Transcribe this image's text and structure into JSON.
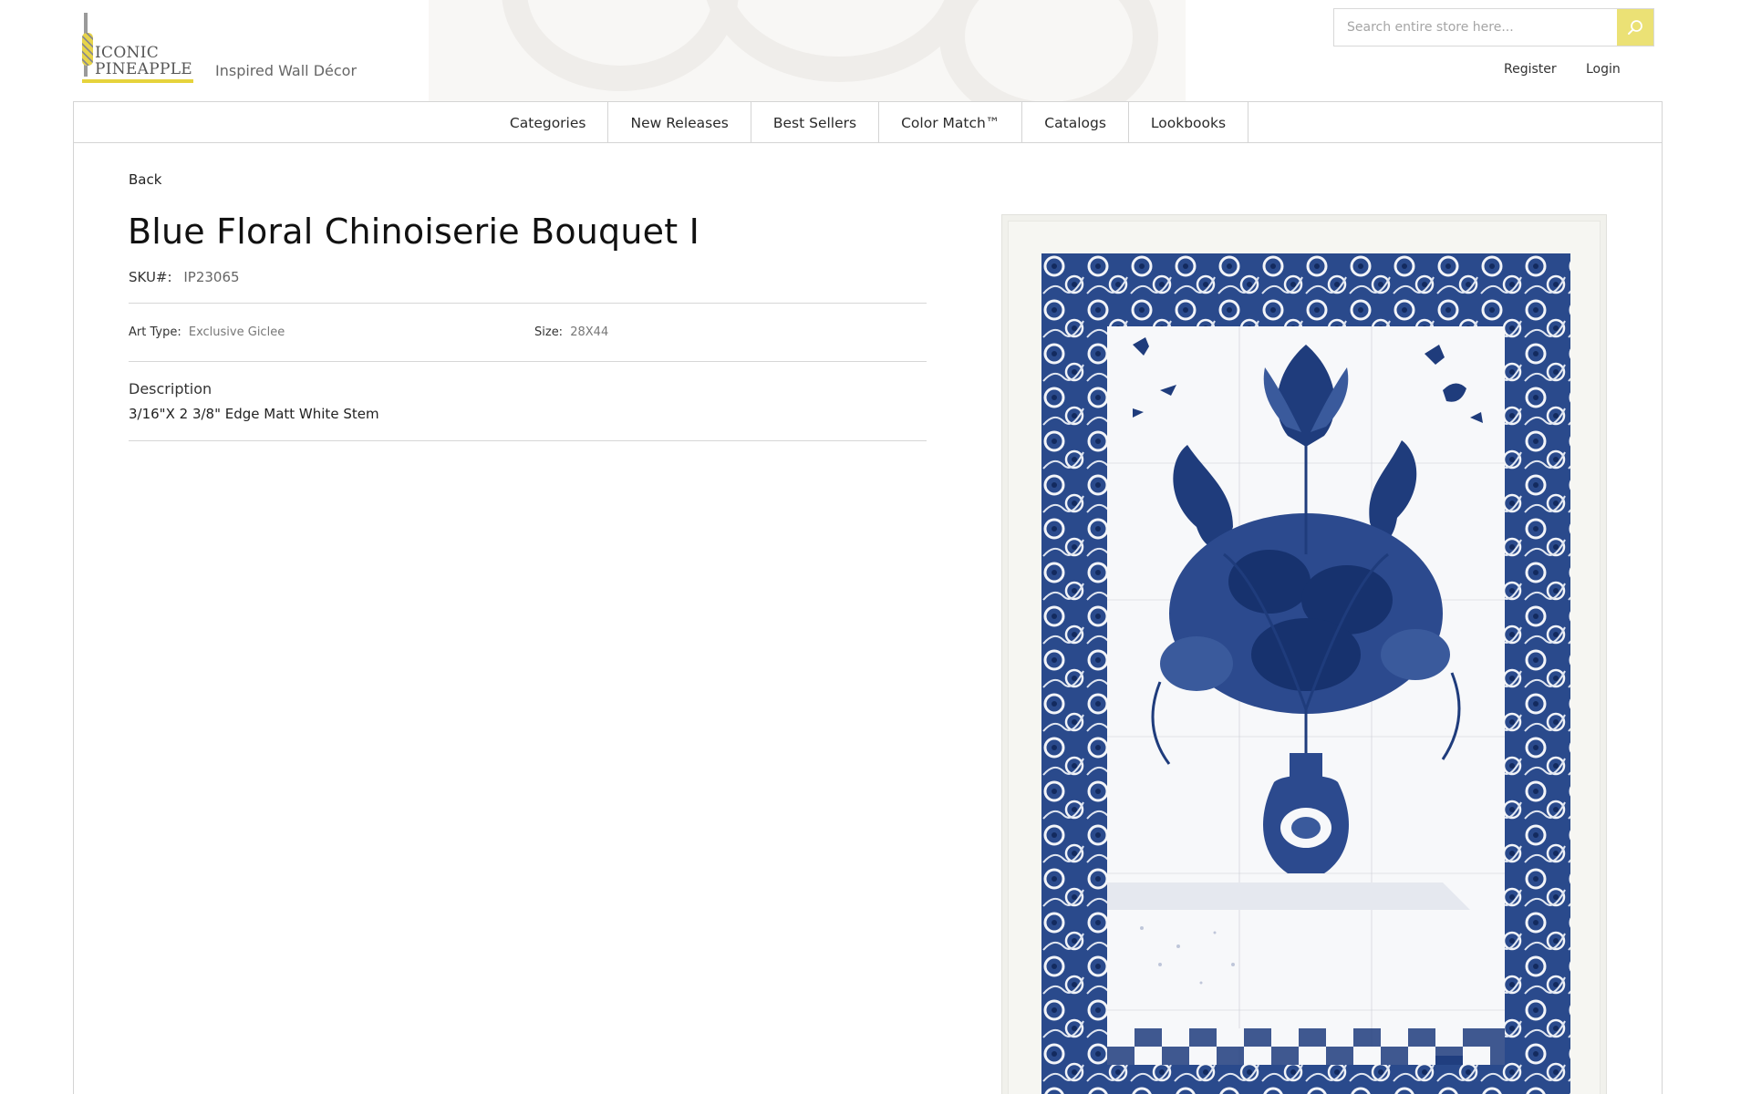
{
  "header": {
    "logo": {
      "line1": "ICONIC",
      "line2": "PINEAPPLE"
    },
    "tagline": "Inspired Wall Décor",
    "search": {
      "placeholder": "Search entire store here...",
      "value": ""
    },
    "register_label": "Register",
    "login_label": "Login"
  },
  "nav": {
    "items": [
      {
        "label": "Categories"
      },
      {
        "label": "New Releases"
      },
      {
        "label": "Best Sellers"
      },
      {
        "label": "Color Match™"
      },
      {
        "label": "Catalogs"
      },
      {
        "label": "Lookbooks"
      }
    ]
  },
  "product": {
    "back_label": "Back",
    "title": "Blue Floral Chinoiserie Bouquet I",
    "sku_label": "SKU#:",
    "sku": "IP23065",
    "art_type_label": "Art Type:",
    "art_type": "Exclusive Giclee",
    "size_label": "Size:",
    "size": "28X44",
    "description_heading": "Description",
    "description": "3/16\"X 2 3/8\" Edge Matt White Stem"
  },
  "icons": {
    "search_button": "search-icon"
  },
  "colors": {
    "accent_yellow": "#ebe175",
    "artwork_blue": "#1f3c7c",
    "border": "#d4d4d4"
  }
}
